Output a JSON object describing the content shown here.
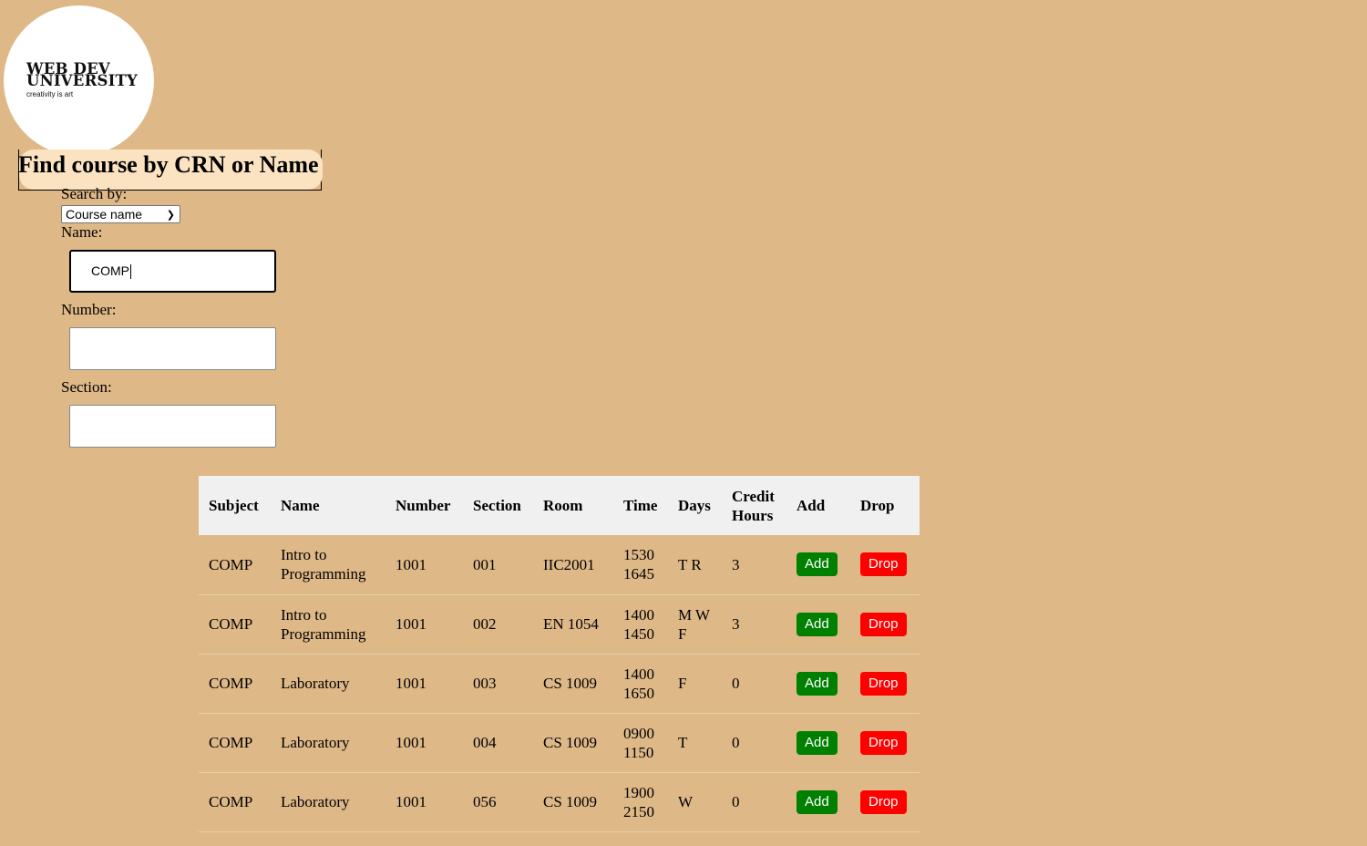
{
  "logo": {
    "line1": "WEB DEV",
    "line2": "UNIVERSITY",
    "tagline": "creativity is art"
  },
  "search": {
    "heading": "Find course by CRN or Name",
    "search_by_label": "Search by:",
    "search_by_value": "Course name",
    "name_label": "Name:",
    "name_value": "COMP",
    "number_label": "Number:",
    "number_value": "",
    "section_label": "Section:",
    "section_value": ""
  },
  "table": {
    "headers": [
      "Subject",
      "Name",
      "Number",
      "Section",
      "Room",
      "Time",
      "Days",
      "Credit Hours",
      "Add",
      "Drop"
    ],
    "add_label": "Add",
    "drop_label": "Drop",
    "rows": [
      {
        "subject": "COMP",
        "name": "Intro to Programming",
        "number": "1001",
        "section": "001",
        "room": "IIC2001",
        "time": "1530 1645",
        "days": "T R",
        "credit": "3"
      },
      {
        "subject": "COMP",
        "name": "Intro to Programming",
        "number": "1001",
        "section": "002",
        "room": "EN 1054",
        "time": "1400 1450",
        "days": "M W F",
        "credit": "3"
      },
      {
        "subject": "COMP",
        "name": "Laboratory",
        "number": "1001",
        "section": "003",
        "room": "CS 1009",
        "time": "1400 1650",
        "days": "F",
        "credit": "0"
      },
      {
        "subject": "COMP",
        "name": "Laboratory",
        "number": "1001",
        "section": "004",
        "room": "CS 1009",
        "time": "0900 1150",
        "days": "T",
        "credit": "0"
      },
      {
        "subject": "COMP",
        "name": "Laboratory",
        "number": "1001",
        "section": "056",
        "room": "CS 1009",
        "time": "1900 2150",
        "days": "W",
        "credit": "0"
      }
    ]
  }
}
